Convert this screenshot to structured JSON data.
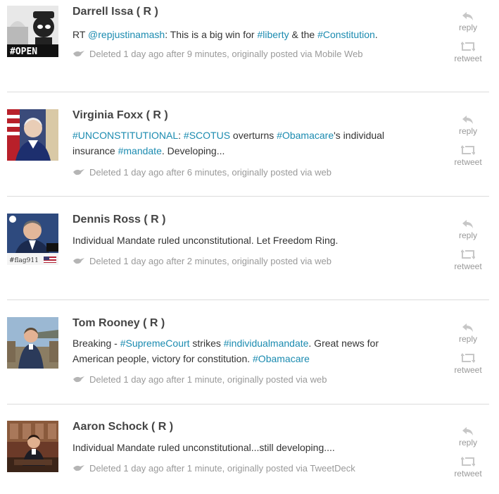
{
  "tweets": [
    {
      "name": "Darrell Issa ( R )",
      "body": [
        {
          "t": "text",
          "v": "RT "
        },
        {
          "t": "link",
          "v": "@repjustinamash"
        },
        {
          "t": "text",
          "v": ": This is a big win for "
        },
        {
          "t": "link",
          "v": "#liberty"
        },
        {
          "t": "text",
          "v": " & the "
        },
        {
          "t": "link",
          "v": "#Constitution"
        },
        {
          "t": "text",
          "v": "."
        }
      ],
      "meta": "Deleted 1 day ago after 9 minutes, originally posted via Mobile Web",
      "avatar_label": "#OPEN"
    },
    {
      "name": "Virginia Foxx ( R )",
      "body": [
        {
          "t": "link",
          "v": "#UNCONSTITUTIONAL"
        },
        {
          "t": "text",
          "v": ": "
        },
        {
          "t": "link",
          "v": "#SCOTUS"
        },
        {
          "t": "text",
          "v": " overturns "
        },
        {
          "t": "link",
          "v": "#Obamacare"
        },
        {
          "t": "text",
          "v": "'s individual insurance "
        },
        {
          "t": "link",
          "v": "#mandate"
        },
        {
          "t": "text",
          "v": ". Developing..."
        }
      ],
      "meta": "Deleted 1 day ago after 6 minutes, originally posted via web",
      "avatar_label": ""
    },
    {
      "name": "Dennis Ross ( R )",
      "body": [
        {
          "t": "text",
          "v": "Individual Mandate ruled unconstitutional. Let Freedom Ring."
        }
      ],
      "meta": "Deleted 1 day ago after 2 minutes, originally posted via web",
      "avatar_label": "#flag911"
    },
    {
      "name": "Tom Rooney ( R )",
      "body": [
        {
          "t": "text",
          "v": "Breaking - "
        },
        {
          "t": "link",
          "v": "#SupremeCourt"
        },
        {
          "t": "text",
          "v": " strikes "
        },
        {
          "t": "link",
          "v": "#individualmandate"
        },
        {
          "t": "text",
          "v": ". Great news for American people, victory for constitution. "
        },
        {
          "t": "link",
          "v": "#Obamacare"
        }
      ],
      "meta": "Deleted 1 day ago after 1 minute, originally posted via web",
      "avatar_label": ""
    },
    {
      "name": "Aaron Schock ( R )",
      "body": [
        {
          "t": "text",
          "v": "Individual Mandate ruled unconstitutional...still developing...."
        }
      ],
      "meta": "Deleted 1 day ago after 1 minute, originally posted via TweetDeck",
      "avatar_label": ""
    }
  ],
  "actions": {
    "reply_label": "reply",
    "retweet_label": "retweet"
  },
  "colors": {
    "link": "#1b8bb0",
    "name": "#444444",
    "meta": "#999999",
    "divider": "#dcdcdc"
  }
}
